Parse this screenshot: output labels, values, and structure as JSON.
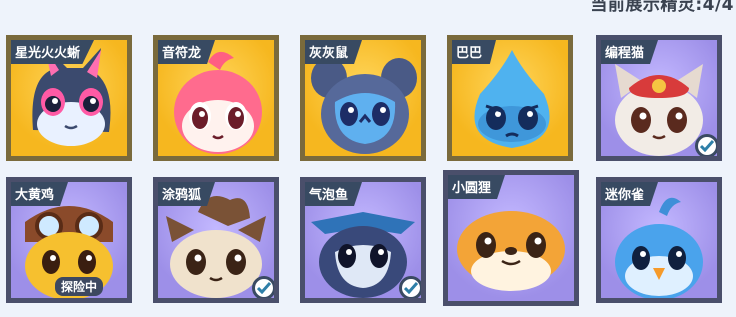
{
  "header": {
    "title": "当前展示精灵:4/4"
  },
  "colors": {
    "gold": "#f3b72a",
    "purple": "#a99cf0",
    "tag": "#384a62"
  },
  "cards": [
    {
      "name": "星光火火蜥",
      "frame": "gold",
      "checked": false,
      "status": ""
    },
    {
      "name": "音符龙",
      "frame": "gold",
      "checked": false,
      "status": ""
    },
    {
      "name": "灰灰鼠",
      "frame": "gold",
      "checked": false,
      "status": ""
    },
    {
      "name": "巴巴",
      "frame": "gold",
      "checked": false,
      "status": ""
    },
    {
      "name": "编程猫",
      "frame": "purple",
      "checked": true,
      "status": ""
    },
    {
      "name": "大黄鸡",
      "frame": "purple",
      "checked": false,
      "status": "探险中"
    },
    {
      "name": "涂鸦狐",
      "frame": "purple",
      "checked": true,
      "status": ""
    },
    {
      "name": "气泡鱼",
      "frame": "purple",
      "checked": true,
      "status": ""
    },
    {
      "name": "小圆狸",
      "frame": "purple",
      "checked": false,
      "status": ""
    },
    {
      "name": "迷你雀",
      "frame": "purple",
      "checked": false,
      "status": ""
    }
  ]
}
